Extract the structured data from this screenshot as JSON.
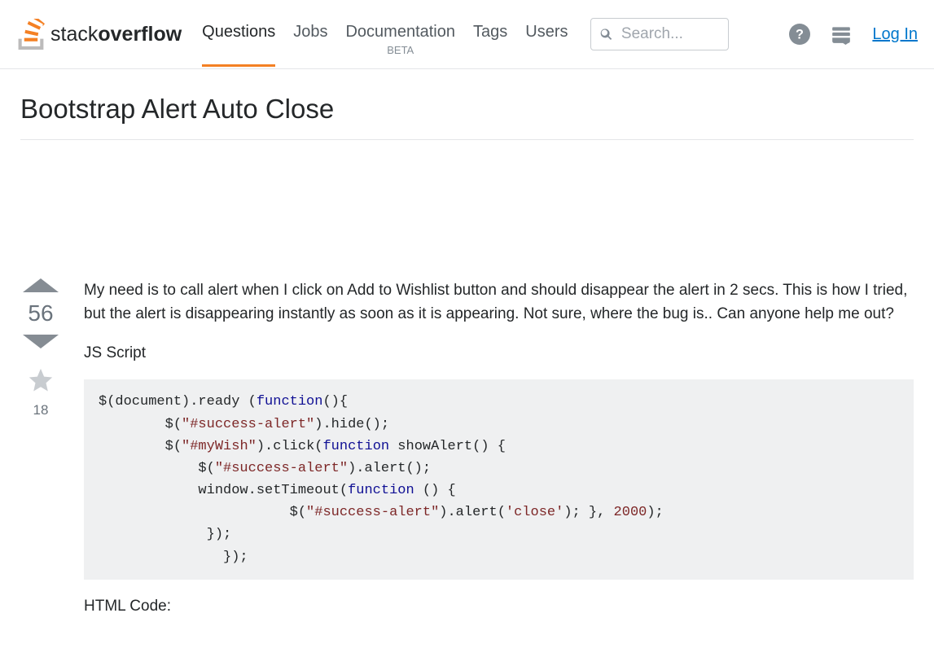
{
  "header": {
    "logo_light": "stack",
    "logo_bold": "overflow",
    "nav": {
      "questions": "Questions",
      "jobs": "Jobs",
      "documentation": "Documentation",
      "beta": "BETA",
      "tags": "Tags",
      "users": "Users"
    },
    "search_placeholder": "Search...",
    "login": "Log In"
  },
  "question": {
    "title": "Bootstrap Alert Auto Close",
    "vote_count": "56",
    "fav_count": "18",
    "body": {
      "p1": "My need is to call alert when I click on Add to Wishlist button and should disappear the alert in 2 secs. This is how I tried, but the alert is disappearing instantly as soon as it is appearing. Not sure, where the bug is.. Can anyone help me out?",
      "js_label": "JS Script",
      "html_label": "HTML Code:"
    },
    "code": {
      "l1a": "$(document).ready (",
      "l1b": "(){",
      "l2a": "        $(",
      "l2b": ").hide();",
      "l3a": "        $(",
      "l3b": ").click(",
      "l3c": " showAlert() {",
      "l4a": "            $(",
      "l4b": ").alert();",
      "l5a": "            window.setTimeout(",
      "l5b": " () {",
      "l6a": "                       $(",
      "l6b": ").alert(",
      "l6c": "); }, ",
      "l6d": ");",
      "l7": "             }); ",
      "l8": "               });",
      "kw_function": "function",
      "str_success": "\"#success-alert\"",
      "str_mywish": "\"#myWish\"",
      "str_close": "'close'",
      "num_2000": "2000"
    }
  }
}
